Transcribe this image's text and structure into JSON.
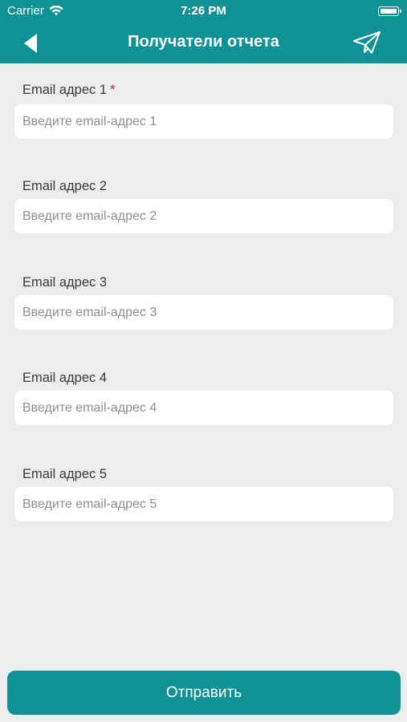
{
  "status_bar": {
    "carrier": "Carrier",
    "time": "7:26 PM",
    "icons": [
      "wifi-icon",
      "battery-icon"
    ]
  },
  "navbar": {
    "title": "Получатели отчета",
    "back_icon": "back-arrow-icon",
    "action_icon": "paper-plane-icon",
    "background_color": "#0f9296"
  },
  "fields": [
    {
      "label": "Email адрес 1",
      "required_mark": "*",
      "placeholder": "Введите email-адрес 1",
      "value": ""
    },
    {
      "label": "Email адрес 2",
      "placeholder": "Введите email-адрес 2",
      "value": ""
    },
    {
      "label": "Email адрес 3",
      "placeholder": "Введите email-адрес 3",
      "value": ""
    },
    {
      "label": "Email адрес 4",
      "placeholder": "Введите email-адрес 4",
      "value": ""
    },
    {
      "label": "Email адрес 5",
      "placeholder": "Введите email-адрес 5",
      "value": ""
    }
  ],
  "submit_button": {
    "label": "Отправить",
    "color": "#0f9296"
  }
}
